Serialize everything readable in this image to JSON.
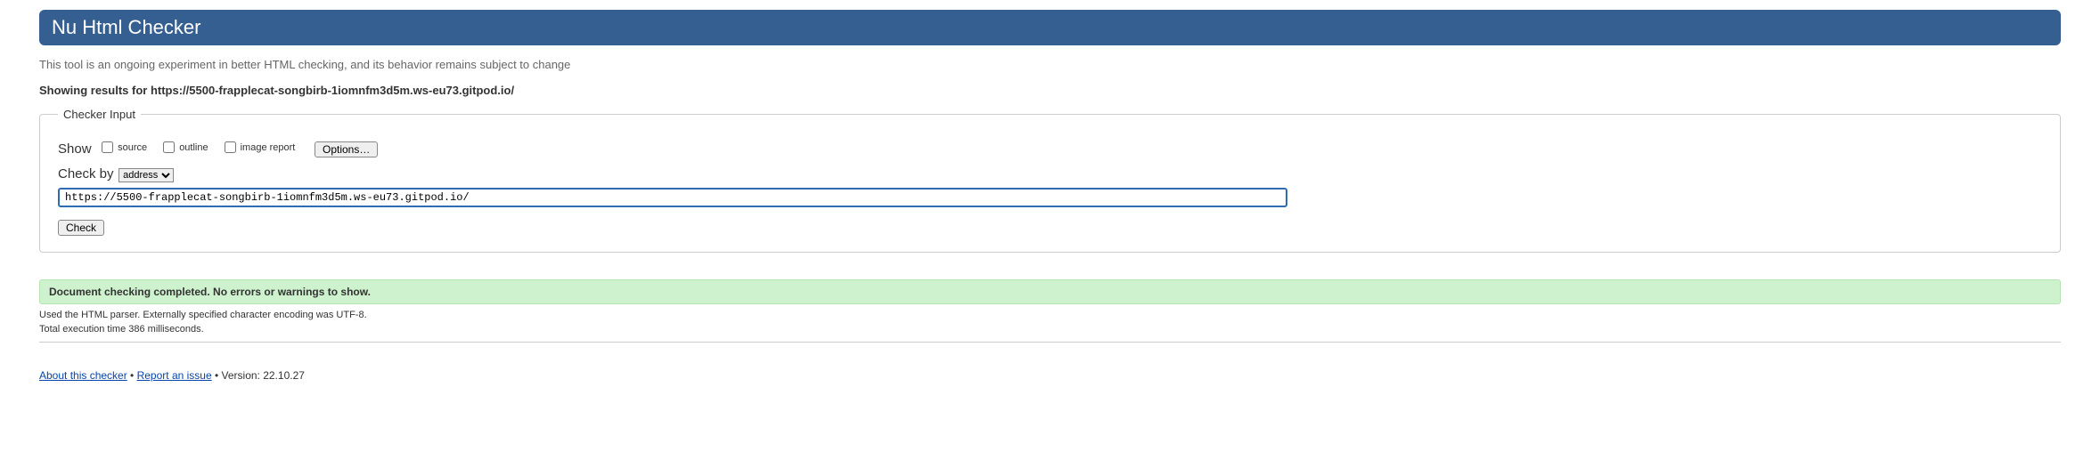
{
  "header": {
    "title": "Nu Html Checker"
  },
  "subtitle": "This tool is an ongoing experiment in better HTML checking, and its behavior remains subject to change",
  "results_heading": "Showing results for https://5500-frapplecat-songbirb-1iomnfm3d5m.ws-eu73.gitpod.io/",
  "form": {
    "legend": "Checker Input",
    "show_label": "Show",
    "checkboxes": {
      "source": "source",
      "outline": "outline",
      "image_report": "image report"
    },
    "options_button": "Options…",
    "checkby_label": "Check by",
    "checkby_selected": "address",
    "url_value": "https://5500-frapplecat-songbirb-1iomnfm3d5m.ws-eu73.gitpod.io/",
    "check_button": "Check"
  },
  "result": {
    "success_message": "Document checking completed. No errors or warnings to show.",
    "parser_info": "Used the HTML parser. Externally specified character encoding was UTF-8.",
    "timing": "Total execution time 386 milliseconds."
  },
  "footer": {
    "about_link": "About this checker",
    "report_link": "Report an issue",
    "separator1": " • ",
    "separator2": " • ",
    "version_label": "Version: 22.10.27"
  }
}
